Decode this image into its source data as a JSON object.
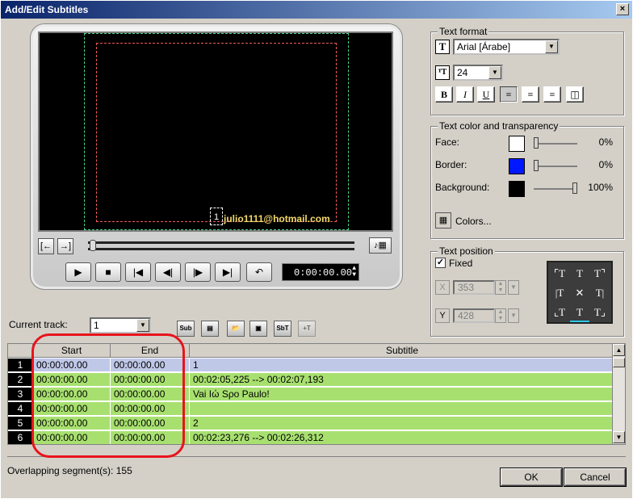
{
  "window": {
    "title": "Add/Edit Subtitles",
    "close_glyph": "×"
  },
  "preview": {
    "subtitle_index": "1",
    "subtitle_text": "julio1111@hotmail.com"
  },
  "transport": {
    "timecode": "0:00:00.00"
  },
  "text_format": {
    "title": "Text format",
    "font": "Arial [Árabe]",
    "size": "24",
    "buttons": [
      "B",
      "I",
      "U"
    ]
  },
  "text_color": {
    "title": "Text color and transparency",
    "face_label": "Face:",
    "face_color": "#ffffff",
    "face_pct": "0%",
    "face_level": 0.0,
    "border_label": "Border:",
    "border_color": "#0018ff",
    "border_pct": "0%",
    "border_level": 0.0,
    "background_label": "Background:",
    "background_color": "#000000",
    "background_pct": "100%",
    "background_level": 1.0,
    "colors_button": "Colors..."
  },
  "text_position": {
    "title": "Text position",
    "fixed_label": "Fixed",
    "fixed_checked": true,
    "x_value": "353",
    "y_value": "428"
  },
  "track": {
    "label": "Current track:",
    "value": "1"
  },
  "table": {
    "columns": [
      "Start",
      "End",
      "Subtitle"
    ],
    "rows": [
      {
        "num": "1",
        "start": "00:00:00.00",
        "end": "00:00:00.00",
        "subtitle": "1"
      },
      {
        "num": "2",
        "start": "00:00:00.00",
        "end": "00:00:00.00",
        "subtitle": "00:02:05,225 --> 00:02:07,193"
      },
      {
        "num": "3",
        "start": "00:00:00.00",
        "end": "00:00:00.00",
        "subtitle": "Vai Ιώ Sρo Paulo!"
      },
      {
        "num": "4",
        "start": "00:00:00.00",
        "end": "00:00:00.00",
        "subtitle": ""
      },
      {
        "num": "5",
        "start": "00:00:00.00",
        "end": "00:00:00.00",
        "subtitle": "2"
      },
      {
        "num": "6",
        "start": "00:00:00.00",
        "end": "00:00:00.00",
        "subtitle": "00:02:23,276 --> 00:02:26,312"
      }
    ]
  },
  "status": {
    "overlapping": "Overlapping segment(s): 155"
  },
  "buttons": {
    "ok": "OK",
    "cancel": "Cancel"
  },
  "colors": {
    "row_selected": "#c0c8e8",
    "row_normal": "#a8e070",
    "annotation": "#e8141c"
  }
}
